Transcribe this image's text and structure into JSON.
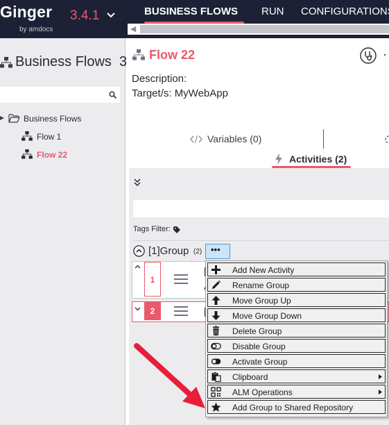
{
  "app": {
    "name": "Ginger",
    "subtitle": "by amdocs",
    "version": "3.4.1",
    "accent_color": "#e8596b",
    "topbar_color": "#1d2135"
  },
  "nav": {
    "tabs": [
      {
        "label": "BUSINESS FLOWS",
        "active": true
      },
      {
        "label": "RUN",
        "active": false
      },
      {
        "label": "CONFIGURATIONS",
        "active": false
      }
    ]
  },
  "left_panel": {
    "title": "Business Flows",
    "title_overflow_char": "3",
    "search_icon": "search-icon",
    "tree": {
      "root": {
        "label": "Business Flows",
        "icon": "folder-icon"
      },
      "items": [
        {
          "label": "Flow 1",
          "icon": "flow-icon",
          "selected": false
        },
        {
          "label": "Flow 22",
          "icon": "flow-icon",
          "selected": true
        }
      ]
    }
  },
  "main": {
    "flow_title": "Flow 22",
    "description_label": "Description:",
    "target_label": "Target/s: MyWebApp",
    "tabs": {
      "variables": "Variables (0)",
      "activities": "Activities (2)"
    },
    "tags_filter_label": "Tags Filter:",
    "group": {
      "label": "[1]Group",
      "count": "(2)",
      "menu_button": "•••"
    },
    "activities": [
      {
        "number": "1",
        "partial_text": "[",
        "partial_text_2": "A"
      },
      {
        "number": "2",
        "partial_text": "["
      }
    ]
  },
  "context_menu": {
    "items": [
      {
        "label": "Add New Activity",
        "icon": "plus-icon",
        "submenu": false
      },
      {
        "label": "Rename Group",
        "icon": "pencil-icon",
        "submenu": false
      },
      {
        "label": "Move Group Up",
        "icon": "arrow-up-icon",
        "submenu": false
      },
      {
        "label": "Move Group Down",
        "icon": "arrow-down-icon",
        "submenu": false
      },
      {
        "label": "Delete Group",
        "icon": "trash-icon",
        "submenu": false
      },
      {
        "label": "Disable Group",
        "icon": "toggle-off-icon",
        "submenu": false
      },
      {
        "label": "Activate Group",
        "icon": "toggle-on-icon",
        "submenu": false
      },
      {
        "label": "Clipboard",
        "icon": "clipboard-icon",
        "submenu": true
      },
      {
        "label": "ALM Operations",
        "icon": "qr-code-icon",
        "submenu": true
      },
      {
        "label": "Add Group to Shared Repository",
        "icon": "star-icon",
        "submenu": false
      }
    ]
  }
}
